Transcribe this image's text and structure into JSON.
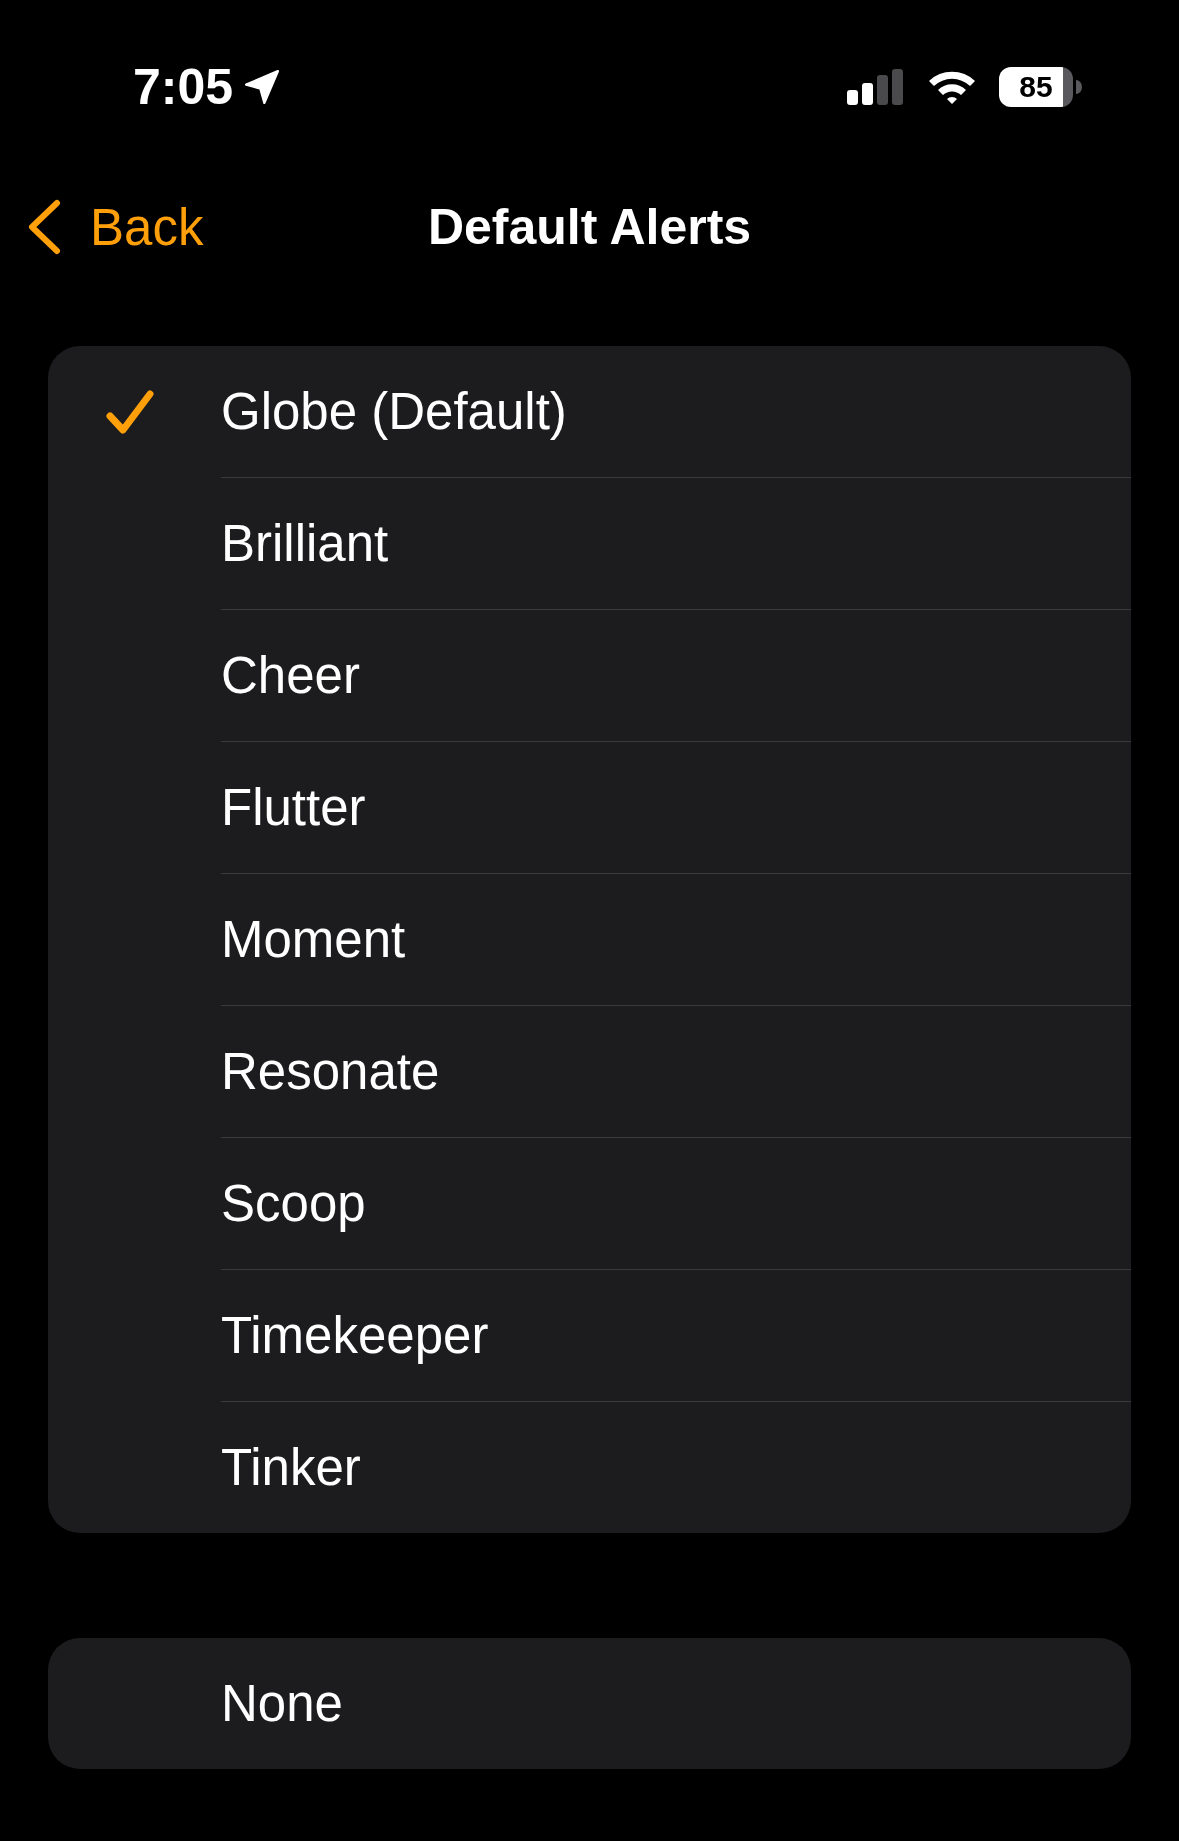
{
  "status_bar": {
    "time": "7:05",
    "battery": "85"
  },
  "nav_bar": {
    "back": "Back",
    "title": "Default Alerts"
  },
  "alerts": [
    {
      "label": "Globe (Default)",
      "selected": true
    },
    {
      "label": "Brilliant",
      "selected": false
    },
    {
      "label": "Cheer",
      "selected": false
    },
    {
      "label": "Flutter",
      "selected": false
    },
    {
      "label": "Moment",
      "selected": false
    },
    {
      "label": "Resonate",
      "selected": false
    },
    {
      "label": "Scoop",
      "selected": false
    },
    {
      "label": "Timekeeper",
      "selected": false
    },
    {
      "label": "Tinker",
      "selected": false
    }
  ],
  "none_option": {
    "label": "None",
    "selected": false
  }
}
